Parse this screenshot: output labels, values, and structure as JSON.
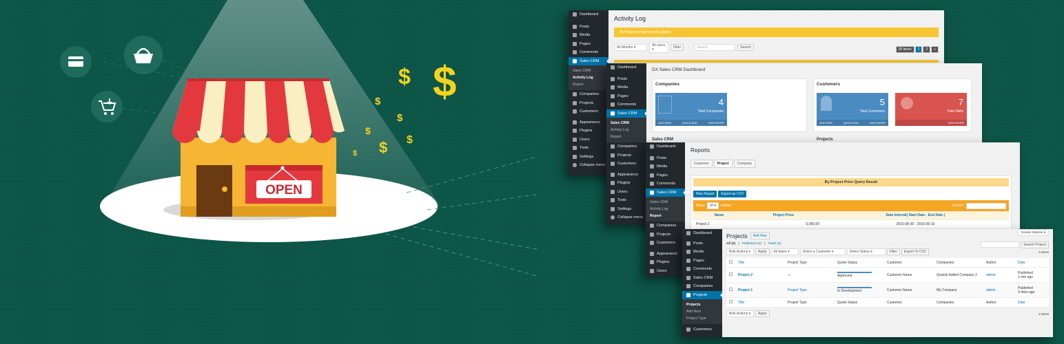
{
  "colors": {
    "bg": "#0c5547",
    "wp_sidebar": "#23282d",
    "wp_blue": "#0073aa",
    "card_blue": "#4a8bc2",
    "card_red": "#d9534f",
    "notice": "#f7c531",
    "awning_red": "#e3393e",
    "awning_cream": "#f9efc2",
    "shop_wall": "#f6b532"
  },
  "hero": {
    "sign": "OPEN",
    "icons": [
      "credit-card-icon",
      "basket-icon",
      "cart-download-icon"
    ]
  },
  "w1": {
    "title": "Activity Log",
    "notice": "All Projects progress and updates",
    "months": "All Months",
    "users": "All users",
    "filter": "Filter",
    "search_ph": "Search",
    "search": "Search",
    "pager": "20 items",
    "p1": "1",
    "p2": "2",
    "p3": "»",
    "menu": [
      "Dashboard",
      "Posts",
      "Media",
      "Pages",
      "Comments",
      "Sales CRM"
    ],
    "sub": [
      "Sales CRM",
      "Activity Log",
      "Report"
    ],
    "menu2": [
      "Companies",
      "Projects",
      "Customers",
      "Appearance",
      "Plugins",
      "Users",
      "Tools",
      "Settings",
      "Collapse menu"
    ]
  },
  "w2": {
    "title": "DX Sales CRM Dashboard",
    "companies": "Companies",
    "customers": "Customers",
    "c_num": "4",
    "c_lbl": "Total Companies",
    "cu_num": "5",
    "cu_lbl": "Total Customers",
    "sk_num": "7",
    "sk_lbl": "Total Skills",
    "add": "ADD NEW",
    "quick": "QUICK ADD",
    "view": "VIEW MORE",
    "sales": "Sales CRM",
    "projects": "Projects",
    "menu": [
      "Dashboard",
      "Posts",
      "Media",
      "Pages",
      "Comments",
      "Sales CRM"
    ],
    "sub": [
      "Sales CRM",
      "Activity Log",
      "Report"
    ],
    "menu2": [
      "Companies",
      "Projects",
      "Customers",
      "Appearance",
      "Plugins",
      "Users",
      "Tools",
      "Settings",
      "Collapse menu"
    ]
  },
  "w3": {
    "title": "Reports",
    "tabs": [
      "Customer",
      "Project",
      "Company"
    ],
    "query": "By Project Price Query Result",
    "new": "New Report",
    "csv": "Export as CSV",
    "show": "Show",
    "entries": "entries",
    "show_n": "10",
    "search": "Search:",
    "cols": [
      "Name",
      "Project Price",
      "Date Interval( Start Date - End Date )"
    ],
    "row": [
      "Project 2",
      "5,000.00",
      "2016-08-30 - 2016-09-15"
    ],
    "menu": [
      "Dashboard",
      "Posts",
      "Media",
      "Pages",
      "Comments",
      "Sales CRM"
    ],
    "sub": [
      "Sales CRM",
      "Activity Log",
      "Report"
    ],
    "menu2": [
      "Companies",
      "Projects",
      "Customers",
      "Appearance",
      "Plugins",
      "Users"
    ]
  },
  "w4": {
    "title": "Projects",
    "add": "Add New",
    "screen": "Screen Options ▾",
    "all": "All (2)",
    "pub": "Published (2)",
    "trash": "Trash (4)",
    "bulk": "Bulk Actions",
    "apply": "Apply",
    "dates": "All dates",
    "cust": "Select a Customer",
    "status": "Select Status",
    "filter": "Filter",
    "export": "Export To CSV",
    "search": "Search Project",
    "items": "2 items",
    "cols": [
      "Title",
      "Project Type",
      "Quote Status",
      "Customer",
      "Companies",
      "Author",
      "Date"
    ],
    "rows": [
      {
        "title": "Project 2",
        "type": "—",
        "status": "Approved",
        "customer": "Customer Name",
        "company": "Quickly Added Company 2",
        "author": "admin",
        "date": "Published",
        "ago": "1 min ago"
      },
      {
        "title": "Project 1",
        "type": "Project Type",
        "status": "In Development",
        "customer": "Customer Name",
        "company": "My Company",
        "author": "admin",
        "date": "Published",
        "ago": "3 mins ago"
      }
    ],
    "menu": [
      "Dashboard",
      "Posts",
      "Media",
      "Pages",
      "Comments",
      "Sales CRM",
      "Companies",
      "Projects"
    ],
    "sub": [
      "Projects",
      "Add New",
      "Project Type"
    ],
    "menu2": [
      "Customers"
    ]
  }
}
